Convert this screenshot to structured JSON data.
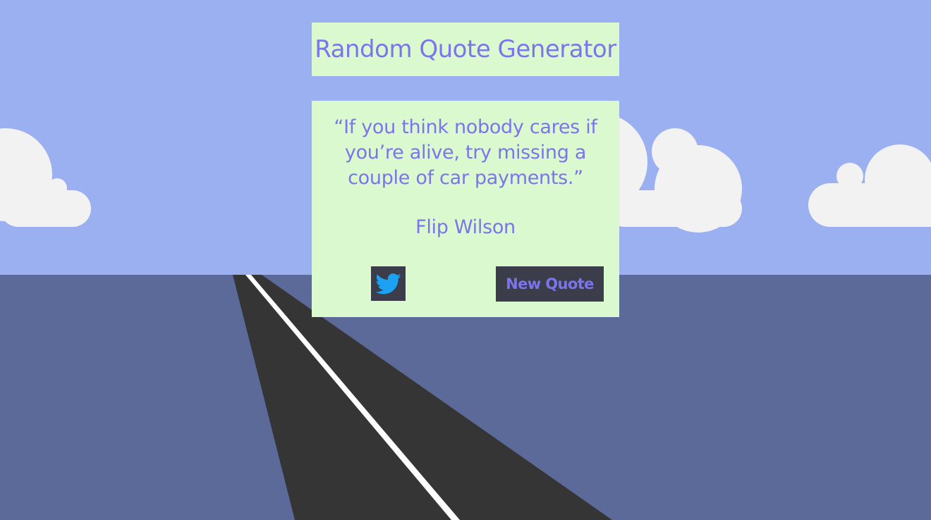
{
  "header": {
    "title": "Random Quote Generator"
  },
  "quote": {
    "text": "“If you think nobody cares if you’re alive, try missing a couple of car payments.”",
    "author": "Flip Wilson"
  },
  "actions": {
    "tweet_icon": "twitter-bird-icon",
    "new_quote_label": "New Quote"
  },
  "colors": {
    "sky": "#9bb0f0",
    "ground": "#5c6a99",
    "road": "#353535",
    "panel": "#dbf9ce",
    "text_accent": "#7b74ec",
    "button_bg": "#3b3d4a",
    "twitter_blue": "#1da1f2",
    "cloud": "#f2f2f2"
  }
}
